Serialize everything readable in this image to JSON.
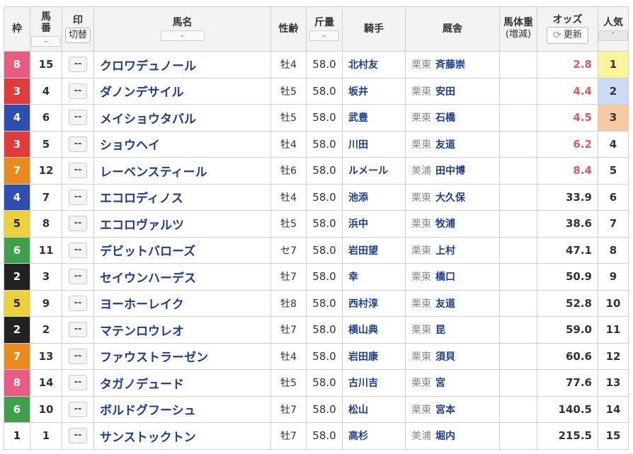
{
  "headers": {
    "waku": "枠",
    "umaban_line1": "馬",
    "umaban_line2": "番",
    "mark_line1": "印",
    "mark_toggle": "切替",
    "horse_name": "馬名",
    "sex_age": "性齢",
    "weight": "斤量",
    "jockey": "騎手",
    "stable": "厩舎",
    "body_weight_line1": "馬体重",
    "body_weight_line2": "(増減)",
    "odds": "オッズ",
    "refresh_label": "更新",
    "popularity": "人気"
  },
  "colors": {
    "waku_1": "#ffffff",
    "waku_2": "#222222",
    "waku_3": "#e23b3b",
    "waku_4": "#2f4fb0",
    "waku_5": "#ecd23a",
    "waku_6": "#3ea04a",
    "waku_7": "#e88a1d",
    "waku_8": "#e85c82",
    "odds_low": "#e05a5a",
    "pop_1": "#fdf59b",
    "pop_2": "#c9dbf7",
    "pop_3": "#f6c9a0"
  },
  "mark_placeholder": "--",
  "rows": [
    {
      "waku": "8",
      "umaban": "15",
      "horse": "クロワデュノール",
      "sex_age": "牡4",
      "weight": "58.0",
      "jockey": "北村友",
      "region": "栗東",
      "trainer": "斉藤崇",
      "odds": "2.8",
      "pop": "1"
    },
    {
      "waku": "3",
      "umaban": "4",
      "horse": "ダノンデサイル",
      "sex_age": "牡5",
      "weight": "58.0",
      "jockey": "坂井",
      "region": "栗東",
      "trainer": "安田",
      "odds": "4.4",
      "pop": "2"
    },
    {
      "waku": "4",
      "umaban": "6",
      "horse": "メイショウタバル",
      "sex_age": "牡5",
      "weight": "58.0",
      "jockey": "武豊",
      "region": "栗東",
      "trainer": "石橋",
      "odds": "4.5",
      "pop": "3"
    },
    {
      "waku": "3",
      "umaban": "5",
      "horse": "ショウヘイ",
      "sex_age": "牡4",
      "weight": "58.0",
      "jockey": "川田",
      "region": "栗東",
      "trainer": "友道",
      "odds": "6.2",
      "pop": "4"
    },
    {
      "waku": "7",
      "umaban": "12",
      "horse": "レーベンスティール",
      "sex_age": "牡6",
      "weight": "58.0",
      "jockey": "ルメール",
      "region": "美浦",
      "trainer": "田中博",
      "odds": "8.4",
      "pop": "5"
    },
    {
      "waku": "4",
      "umaban": "7",
      "horse": "エコロディノス",
      "sex_age": "牡4",
      "weight": "58.0",
      "jockey": "池添",
      "region": "栗東",
      "trainer": "大久保",
      "odds": "33.9",
      "pop": "6"
    },
    {
      "waku": "5",
      "umaban": "8",
      "horse": "エコロヴァルツ",
      "sex_age": "牡5",
      "weight": "58.0",
      "jockey": "浜中",
      "region": "栗東",
      "trainer": "牧浦",
      "odds": "38.6",
      "pop": "7"
    },
    {
      "waku": "6",
      "umaban": "11",
      "horse": "デビットバローズ",
      "sex_age": "セ7",
      "weight": "58.0",
      "jockey": "岩田望",
      "region": "栗東",
      "trainer": "上村",
      "odds": "47.1",
      "pop": "8"
    },
    {
      "waku": "2",
      "umaban": "3",
      "horse": "セイウンハーデス",
      "sex_age": "牡7",
      "weight": "58.0",
      "jockey": "幸",
      "region": "栗東",
      "trainer": "橋口",
      "odds": "50.9",
      "pop": "9"
    },
    {
      "waku": "5",
      "umaban": "9",
      "horse": "ヨーホーレイク",
      "sex_age": "牡8",
      "weight": "58.0",
      "jockey": "西村淳",
      "region": "栗東",
      "trainer": "友道",
      "odds": "52.8",
      "pop": "10"
    },
    {
      "waku": "2",
      "umaban": "2",
      "horse": "マテンロウレオ",
      "sex_age": "牡7",
      "weight": "58.0",
      "jockey": "横山典",
      "region": "栗東",
      "trainer": "昆",
      "odds": "59.0",
      "pop": "11"
    },
    {
      "waku": "7",
      "umaban": "13",
      "horse": "ファウストラーゼン",
      "sex_age": "牡4",
      "weight": "58.0",
      "jockey": "岩田康",
      "region": "栗東",
      "trainer": "須貝",
      "odds": "60.6",
      "pop": "12"
    },
    {
      "waku": "8",
      "umaban": "14",
      "horse": "タガノデュード",
      "sex_age": "牡5",
      "weight": "58.0",
      "jockey": "古川吉",
      "region": "栗東",
      "trainer": "宮",
      "odds": "77.6",
      "pop": "13"
    },
    {
      "waku": "6",
      "umaban": "10",
      "horse": "ボルドグフーシュ",
      "sex_age": "牡7",
      "weight": "58.0",
      "jockey": "松山",
      "region": "栗東",
      "trainer": "宮本",
      "odds": "140.5",
      "pop": "14"
    },
    {
      "waku": "1",
      "umaban": "1",
      "horse": "サンストックトン",
      "sex_age": "牡7",
      "weight": "58.0",
      "jockey": "高杉",
      "region": "美浦",
      "trainer": "堀内",
      "odds": "215.5",
      "pop": "15"
    }
  ]
}
